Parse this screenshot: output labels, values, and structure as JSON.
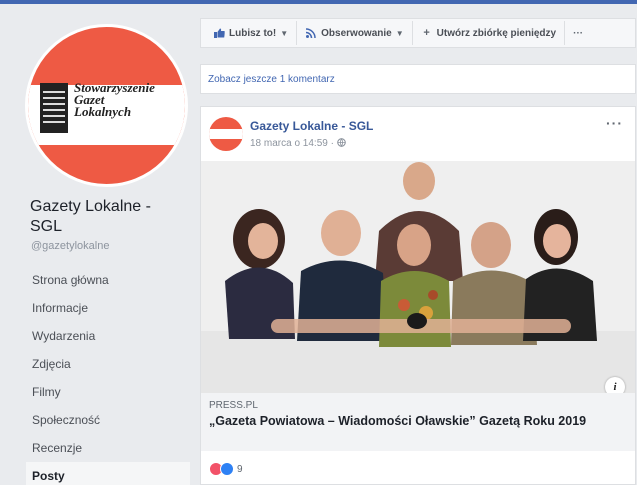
{
  "sidebar": {
    "page_name": "Gazety Lokalne - SGL",
    "handle": "@gazetylokalne",
    "logo_text": [
      "Stowarzyszenie",
      "Gazet",
      "Lokalnych"
    ],
    "nav": [
      {
        "label": "Strona główna",
        "active": false
      },
      {
        "label": "Informacje",
        "active": false
      },
      {
        "label": "Wydarzenia",
        "active": false
      },
      {
        "label": "Zdjęcia",
        "active": false
      },
      {
        "label": "Filmy",
        "active": false
      },
      {
        "label": "Społeczność",
        "active": false
      },
      {
        "label": "Recenzje",
        "active": false
      },
      {
        "label": "Posty",
        "active": true
      }
    ]
  },
  "actionbar": {
    "like_label": "Lubisz to!",
    "follow_label": "Obserwowanie",
    "fundraiser_label": "Utwórz zbiórkę pieniędzy",
    "more_label": "···"
  },
  "comments": {
    "more_label": "Zobacz jeszcze 1 komentarz"
  },
  "post": {
    "author": "Gazety Lokalne - SGL",
    "timestamp": "18 marca o 14:59 ·",
    "menu_label": "···",
    "link_source": "PRESS.PL",
    "link_title": "„Gazeta Powiatowa – Wiadomości Oławskie” Gazetą Roku 2019",
    "reaction_count": "9"
  },
  "colors": {
    "accent": "#4267b2",
    "brand_red": "#ee5a44",
    "love": "#f25268",
    "like": "#2e81f4"
  },
  "icons": {
    "like": "thumbs-up-icon",
    "follow": "rss-icon",
    "fundraiser": "plus-icon",
    "privacy": "globe-icon",
    "info": "info-icon"
  }
}
